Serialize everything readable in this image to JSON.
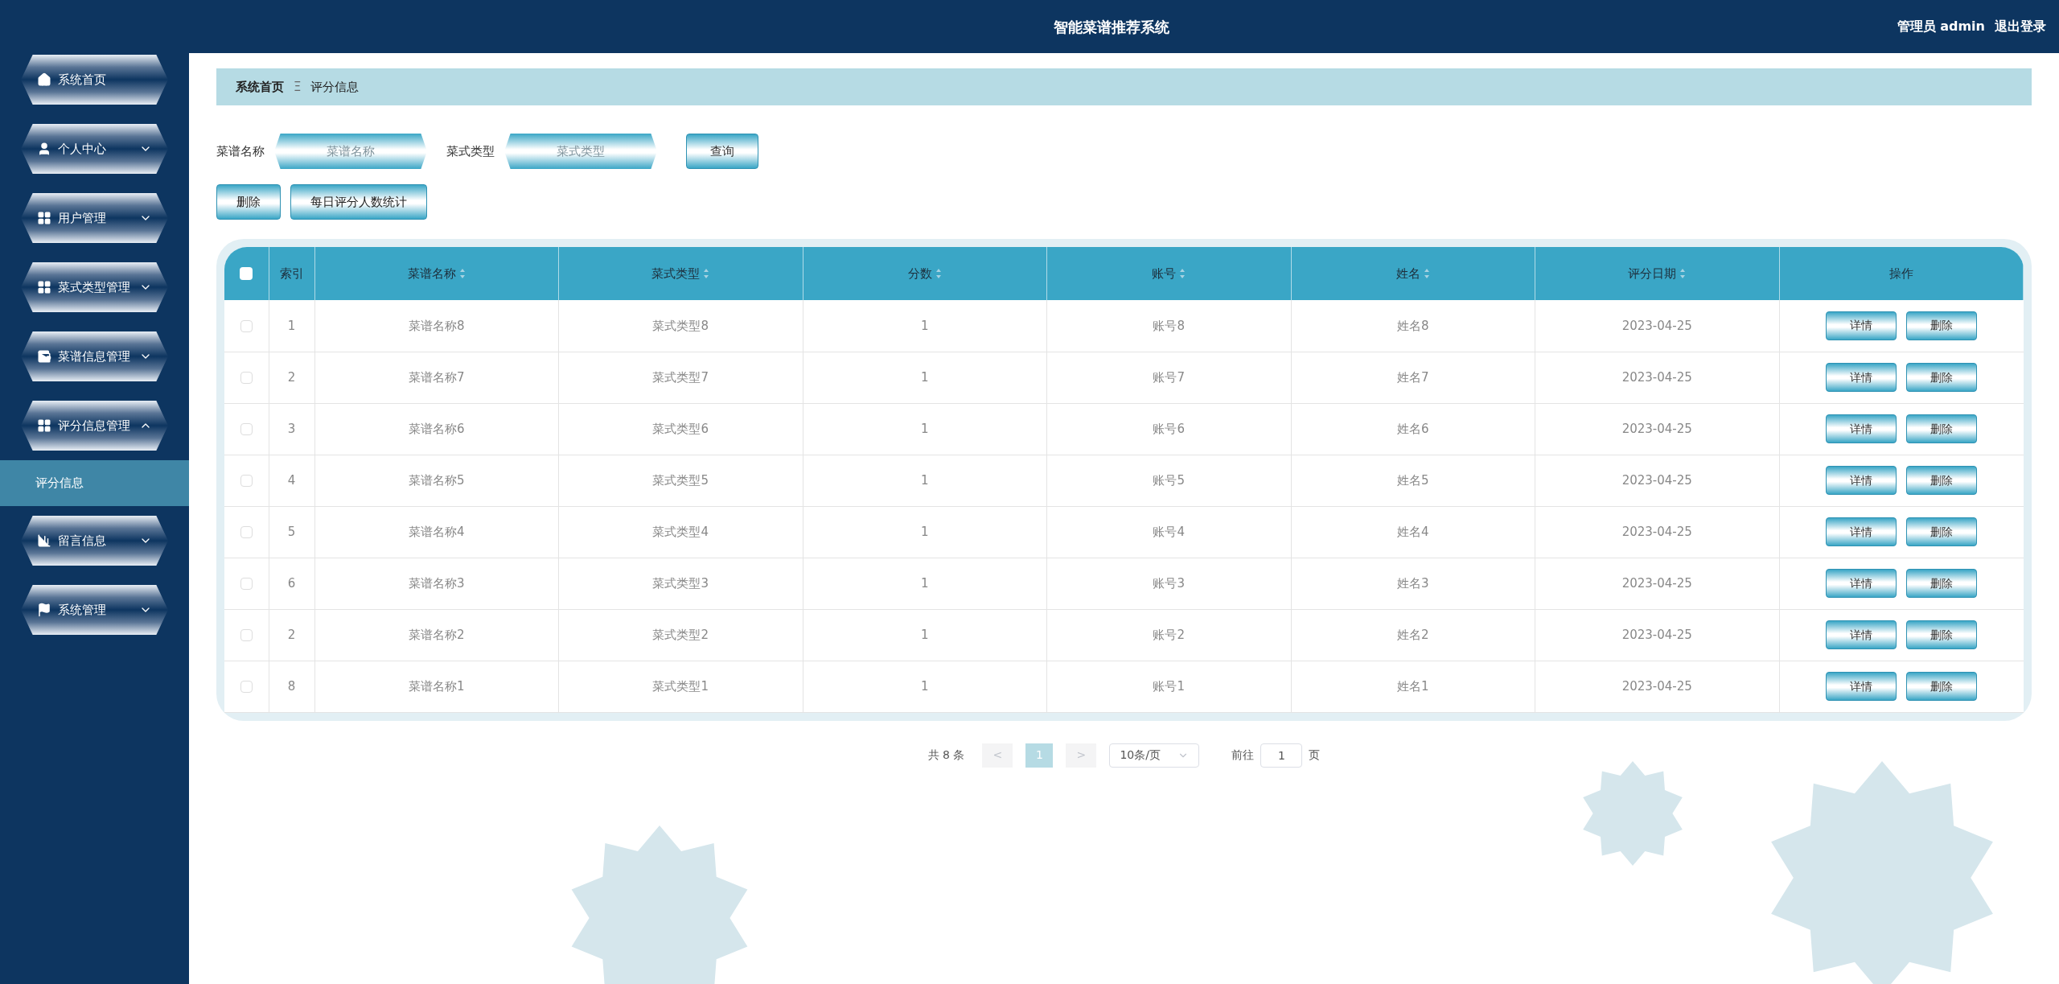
{
  "header": {
    "title": "智能菜谱推荐系统",
    "user": "管理员 admin",
    "logout": "退出登录"
  },
  "sidebar": {
    "items": [
      {
        "label": "系统首页",
        "has_caret": false
      },
      {
        "label": "个人中心",
        "expanded": false,
        "has_caret": true
      },
      {
        "label": "用户管理",
        "expanded": false,
        "has_caret": true
      },
      {
        "label": "菜式类型管理",
        "expanded": false,
        "has_caret": true
      },
      {
        "label": "菜谱信息管理",
        "expanded": false,
        "has_caret": true
      },
      {
        "label": "评分信息管理",
        "expanded": true,
        "has_caret": true,
        "children": [
          {
            "label": "评分信息",
            "selected": true
          }
        ]
      },
      {
        "label": "留言信息",
        "expanded": false,
        "has_caret": true
      },
      {
        "label": "系统管理",
        "expanded": false,
        "has_caret": true
      }
    ]
  },
  "breadcrumb": [
    "系统首页",
    "评分信息"
  ],
  "breadcrumb_separator": "Ξ",
  "search": {
    "fields": [
      {
        "label": "菜谱名称",
        "placeholder": "菜谱名称"
      },
      {
        "label": "菜式类型",
        "placeholder": "菜式类型"
      }
    ],
    "button": "查询"
  },
  "actions": [
    "删除",
    "每日评分人数统计"
  ],
  "table": {
    "all_checked": false,
    "columns": [
      {
        "label": "索引",
        "sortable": false
      },
      {
        "label": "菜谱名称",
        "sortable": true
      },
      {
        "label": "菜式类型",
        "sortable": true
      },
      {
        "label": "分数",
        "sortable": true
      },
      {
        "label": "账号",
        "sortable": true
      },
      {
        "label": "姓名",
        "sortable": true
      },
      {
        "label": "评分日期",
        "sortable": true
      },
      {
        "label": "操作",
        "sortable": false
      }
    ],
    "rows": [
      {
        "checked": false,
        "cells": [
          "1",
          "菜谱名称8",
          "菜式类型8",
          "1",
          "账号8",
          "姓名8",
          "2023-04-25"
        ],
        "buttons": [
          "详情",
          "删除"
        ]
      },
      {
        "checked": false,
        "cells": [
          "2",
          "菜谱名称7",
          "菜式类型7",
          "1",
          "账号7",
          "姓名7",
          "2023-04-25"
        ],
        "buttons": [
          "详情",
          "删除"
        ]
      },
      {
        "checked": false,
        "cells": [
          "3",
          "菜谱名称6",
          "菜式类型6",
          "1",
          "账号6",
          "姓名6",
          "2023-04-25"
        ],
        "buttons": [
          "详情",
          "删除"
        ]
      },
      {
        "checked": false,
        "cells": [
          "4",
          "菜谱名称5",
          "菜式类型5",
          "1",
          "账号5",
          "姓名5",
          "2023-04-25"
        ],
        "buttons": [
          "详情",
          "删除"
        ]
      },
      {
        "checked": false,
        "cells": [
          "5",
          "菜谱名称4",
          "菜式类型4",
          "1",
          "账号4",
          "姓名4",
          "2023-04-25"
        ],
        "buttons": [
          "详情",
          "删除"
        ]
      },
      {
        "checked": false,
        "cells": [
          "6",
          "菜谱名称3",
          "菜式类型3",
          "1",
          "账号3",
          "姓名3",
          "2023-04-25"
        ],
        "buttons": [
          "详情",
          "删除"
        ]
      },
      {
        "checked": false,
        "cells": [
          "2",
          "菜谱名称2",
          "菜式类型2",
          "1",
          "账号2",
          "姓名2",
          "2023-04-25"
        ],
        "buttons": [
          "详情",
          "删除"
        ]
      },
      {
        "checked": false,
        "cells": [
          "8",
          "菜谱名称1",
          "菜式类型1",
          "1",
          "账号1",
          "姓名1",
          "2023-04-25"
        ],
        "buttons": [
          "详情",
          "删除"
        ]
      }
    ]
  },
  "pagination": {
    "total": "共 8 条",
    "prev": "<",
    "pages": [
      {
        "label": "1",
        "selected": true
      }
    ],
    "next": ">",
    "page_size": "10条/页",
    "goto_label": "前往",
    "goto_value": "1",
    "goto_suffix": "页"
  }
}
